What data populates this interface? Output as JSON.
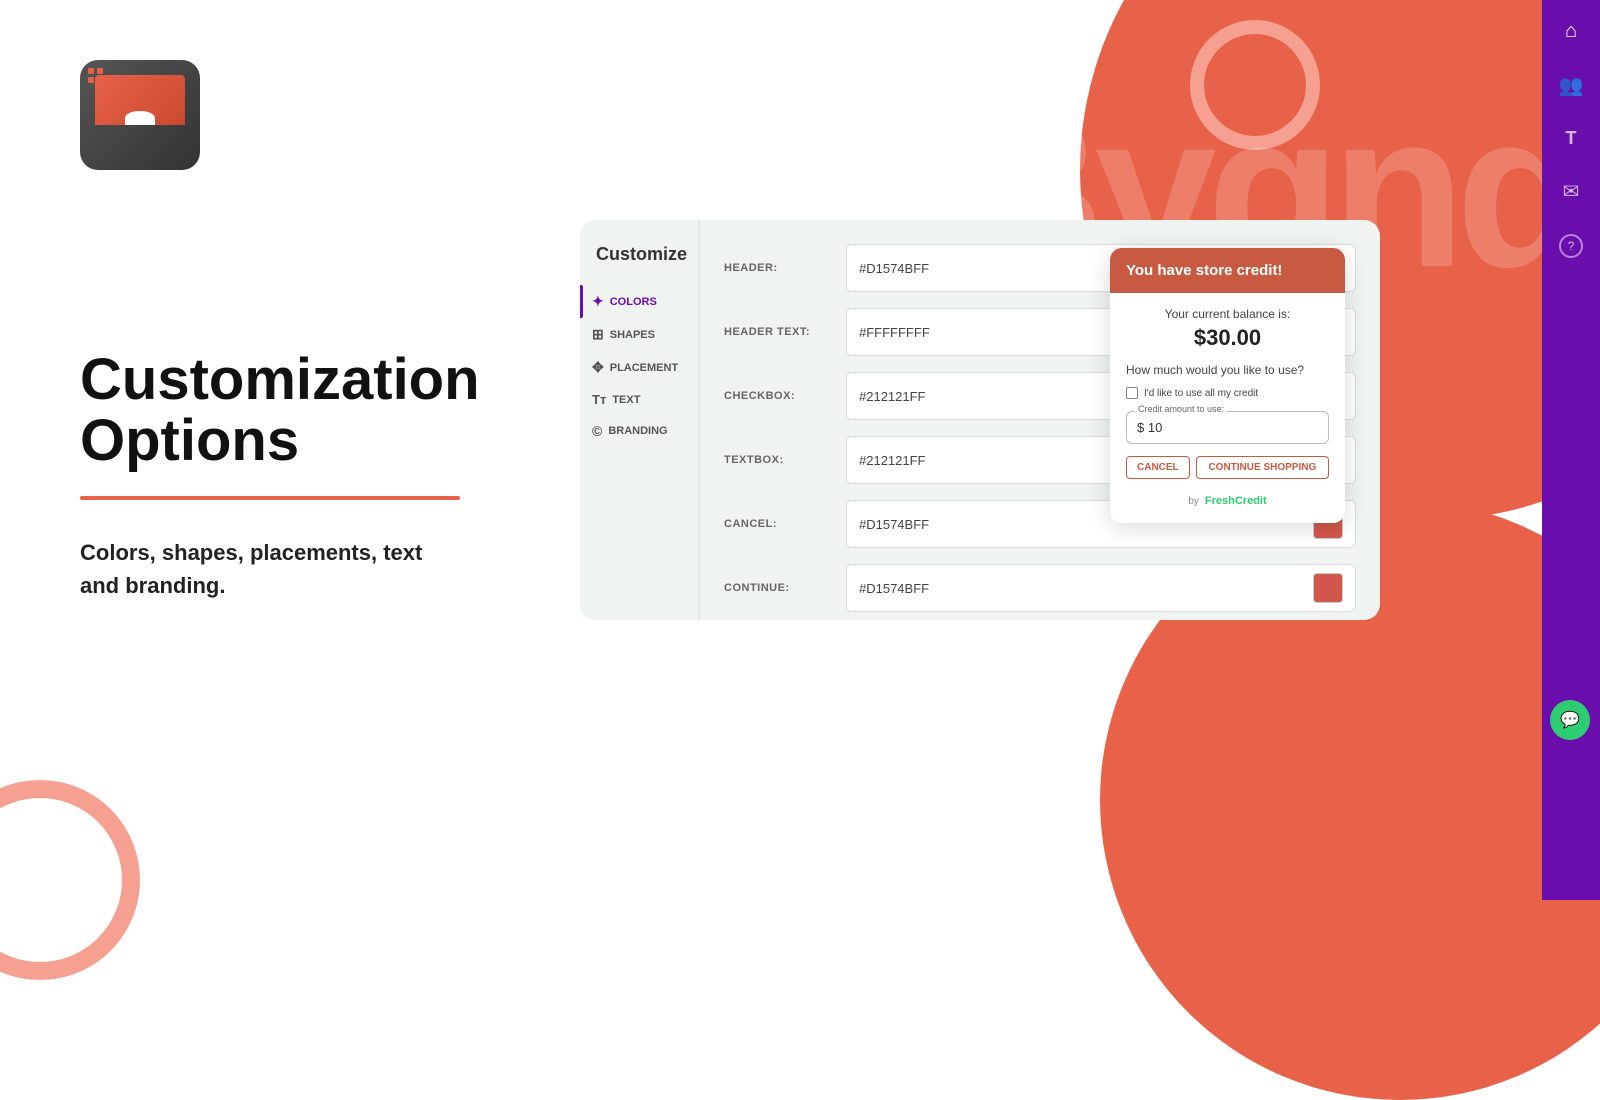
{
  "page": {
    "title": "Customization Options"
  },
  "hero": {
    "heading_line1": "Customization",
    "heading_line2": "Options",
    "subtext": "Colors, shapes, placements, text\nand branding.",
    "watermark": "Bygnd"
  },
  "customize": {
    "title": "Customize",
    "sidebar_items": [
      {
        "id": "colors",
        "label": "COLORS",
        "icon": "✦",
        "active": true
      },
      {
        "id": "shapes",
        "label": "SHAPES",
        "icon": "⊞",
        "active": false
      },
      {
        "id": "placement",
        "label": "PLACEMENT",
        "icon": "✥",
        "active": false
      },
      {
        "id": "text",
        "label": "TEXT",
        "icon": "T",
        "active": false
      },
      {
        "id": "branding",
        "label": "BRANDING",
        "icon": "©",
        "active": false
      }
    ],
    "color_fields": [
      {
        "label": "HEADER:",
        "value": "#D1574BFF",
        "swatch": "#D1574B"
      },
      {
        "label": "HEADER TEXT:",
        "value": "#FFFFFFFF",
        "swatch": "#FFFFFF"
      },
      {
        "label": "CHECKBOX:",
        "value": "#212121FF",
        "swatch": "#212121"
      },
      {
        "label": "TEXTBOX:",
        "value": "#212121FF",
        "swatch": "#212121"
      },
      {
        "label": "CANCEL:",
        "value": "#D1574BFF",
        "swatch": "#D1574B"
      },
      {
        "label": "CONTINUE:",
        "value": "#D1574BFF",
        "swatch": "#D1574B"
      }
    ]
  },
  "preview_widget": {
    "header_title": "You have store credit!",
    "header_bg": "#C85A42",
    "balance_label": "Your current balance is:",
    "balance_amount": "$30.00",
    "question": "How much would you like to use?",
    "checkbox_label": "I'd like to use all my credit",
    "credit_legend": "Credit amount to use:",
    "credit_value": "$ 10",
    "btn_cancel": "CANCEL",
    "btn_continue": "CONTINUE SHOPPING",
    "footer_by": "by",
    "footer_brand": "FreshCredit"
  },
  "right_sidebar": {
    "icons": [
      "🏠",
      "👥",
      "T",
      "✉",
      "?"
    ]
  }
}
